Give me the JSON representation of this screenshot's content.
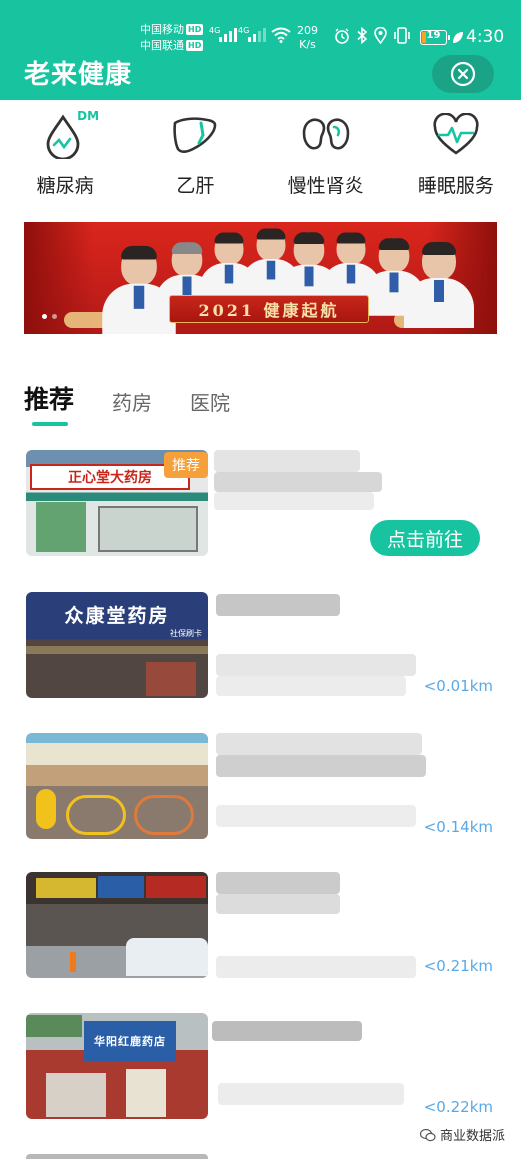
{
  "status_bar": {
    "carrier_1": "中国移动",
    "carrier_2": "中国联通",
    "hd_badge": "HD",
    "network_1": "4G",
    "network_2": "4G",
    "speed_value": "209",
    "speed_unit": "K/s",
    "battery": "19",
    "battery_level": 0.19,
    "time": "4:30"
  },
  "header": {
    "title": "老来健康"
  },
  "categories": [
    {
      "label": "糖尿病",
      "icon": "diabetes-drop-icon",
      "badge": "DM"
    },
    {
      "label": "乙肝",
      "icon": "liver-icon"
    },
    {
      "label": "慢性肾炎",
      "icon": "kidney-icon"
    },
    {
      "label": "睡眠服务",
      "icon": "heart-pulse-icon"
    }
  ],
  "banner": {
    "caption": "2021 健康起航",
    "dots": 2,
    "active_dot": 0
  },
  "tabs": [
    {
      "label": "推荐",
      "active": true
    },
    {
      "label": "药房",
      "active": false
    },
    {
      "label": "医院",
      "active": false
    }
  ],
  "stores": [
    {
      "sign_text": "正心堂大药房",
      "tag": "推荐",
      "button": "点击前往",
      "distance": ""
    },
    {
      "sign_text": "众康堂药房",
      "sub_sign": "社保刷卡",
      "distance": "<0.01km"
    },
    {
      "sign_text": "",
      "distance": "<0.14km"
    },
    {
      "sign_text": "",
      "distance": "<0.21km"
    },
    {
      "sign_text": "华阳红鹿药店",
      "distance": "<0.22km"
    }
  ],
  "watermark": "商业数据派",
  "colors": {
    "brand_green": "#18c4a0",
    "distance_blue": "#5aa9e6",
    "tag_orange": "#f5a03a",
    "banner_red": "#c41e1a"
  }
}
